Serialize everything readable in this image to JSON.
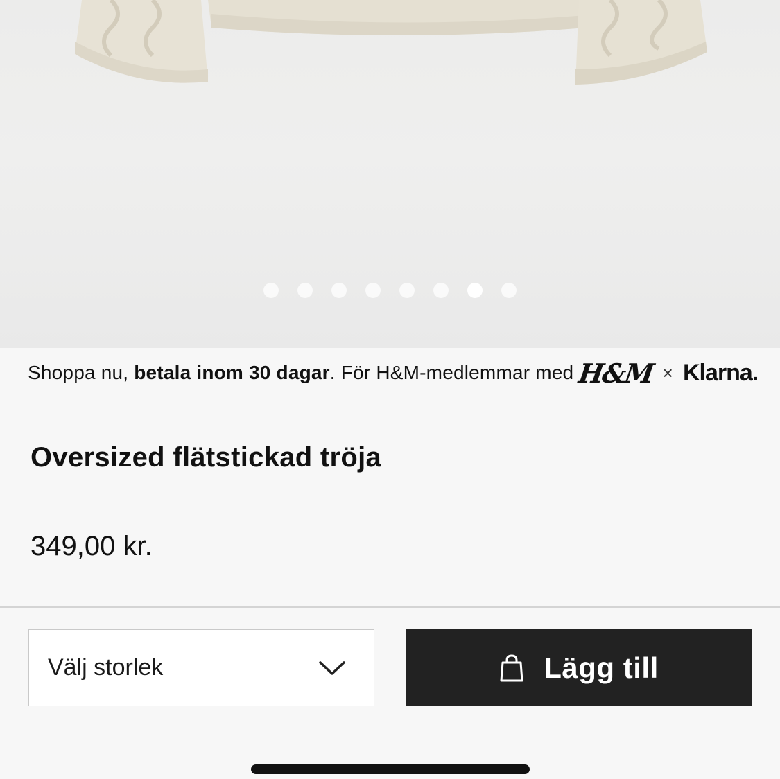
{
  "product_image": {
    "carousel": {
      "total_images": 8,
      "active_index": 7
    }
  },
  "promo": {
    "text_start": "Shoppa nu, ",
    "text_bold": "betala inom 30 dagar",
    "text_end": ". För H&M-medlemmar med",
    "hm_logo": "H&M",
    "separator": "×",
    "partner_logo": "Klarna."
  },
  "product": {
    "title": "Oversized flätstickad tröja",
    "price": "349,00 kr."
  },
  "actions": {
    "size_select_label": "Välj storlek",
    "add_to_cart_label": "Lägg till"
  },
  "icons": {
    "size_chevron": "chevron-down-icon",
    "cart": "shopping-bag-icon"
  },
  "colors": {
    "button_bg": "#222222",
    "background": "#f7f7f7"
  }
}
